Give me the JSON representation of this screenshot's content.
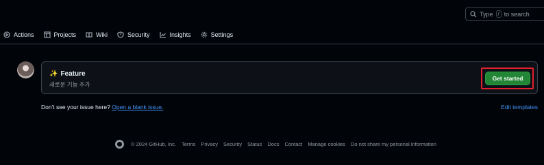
{
  "search": {
    "prefix": "Type",
    "key": "/",
    "suffix": "to search"
  },
  "nav": {
    "items": [
      {
        "label": "Actions",
        "icon": "play-circle-icon"
      },
      {
        "label": "Projects",
        "icon": "table-icon"
      },
      {
        "label": "Wiki",
        "icon": "book-icon"
      },
      {
        "label": "Security",
        "icon": "shield-icon"
      },
      {
        "label": "Insights",
        "icon": "graph-icon"
      },
      {
        "label": "Settings",
        "icon": "gear-icon"
      }
    ]
  },
  "template": {
    "emoji": "✨",
    "title": "Feature",
    "description": "새로운 기능 추가",
    "button_label": "Get started"
  },
  "issue": {
    "prompt": "Don't see your issue here?",
    "link": "Open a blank issue.",
    "edit_templates": "Edit templates"
  },
  "footer": {
    "copyright": "© 2024 GitHub, Inc.",
    "links": [
      "Terms",
      "Privacy",
      "Security",
      "Status",
      "Docs",
      "Contact",
      "Manage cookies",
      "Do not share my personal information"
    ]
  },
  "colors": {
    "background": "#010409",
    "card_bg": "#0d1117",
    "border": "#3d444d",
    "link": "#4493f8",
    "button_green": "#238636",
    "highlight_red": "#e5202e"
  }
}
